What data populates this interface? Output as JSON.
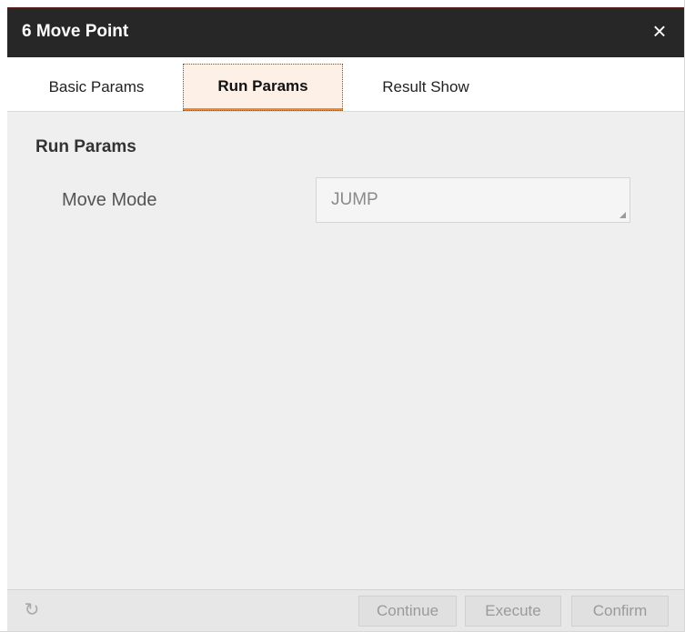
{
  "dialog": {
    "title": "6 Move Point",
    "close_icon": "×"
  },
  "tabs": [
    {
      "label": "Basic Params",
      "active": false
    },
    {
      "label": "Run Params",
      "active": true
    },
    {
      "label": "Result Show",
      "active": false
    }
  ],
  "content": {
    "section_title": "Run Params",
    "move_mode_label": "Move Mode",
    "move_mode_value": "JUMP"
  },
  "footer": {
    "refresh_icon": "↻",
    "buttons": {
      "continue": "Continue",
      "execute": "Execute",
      "confirm": "Confirm"
    }
  },
  "colors": {
    "titlebar": "#272727",
    "active_tab_accent": "#f08a2c",
    "active_tab_bg": "#fdf1e7",
    "content_bg": "#efefef"
  }
}
